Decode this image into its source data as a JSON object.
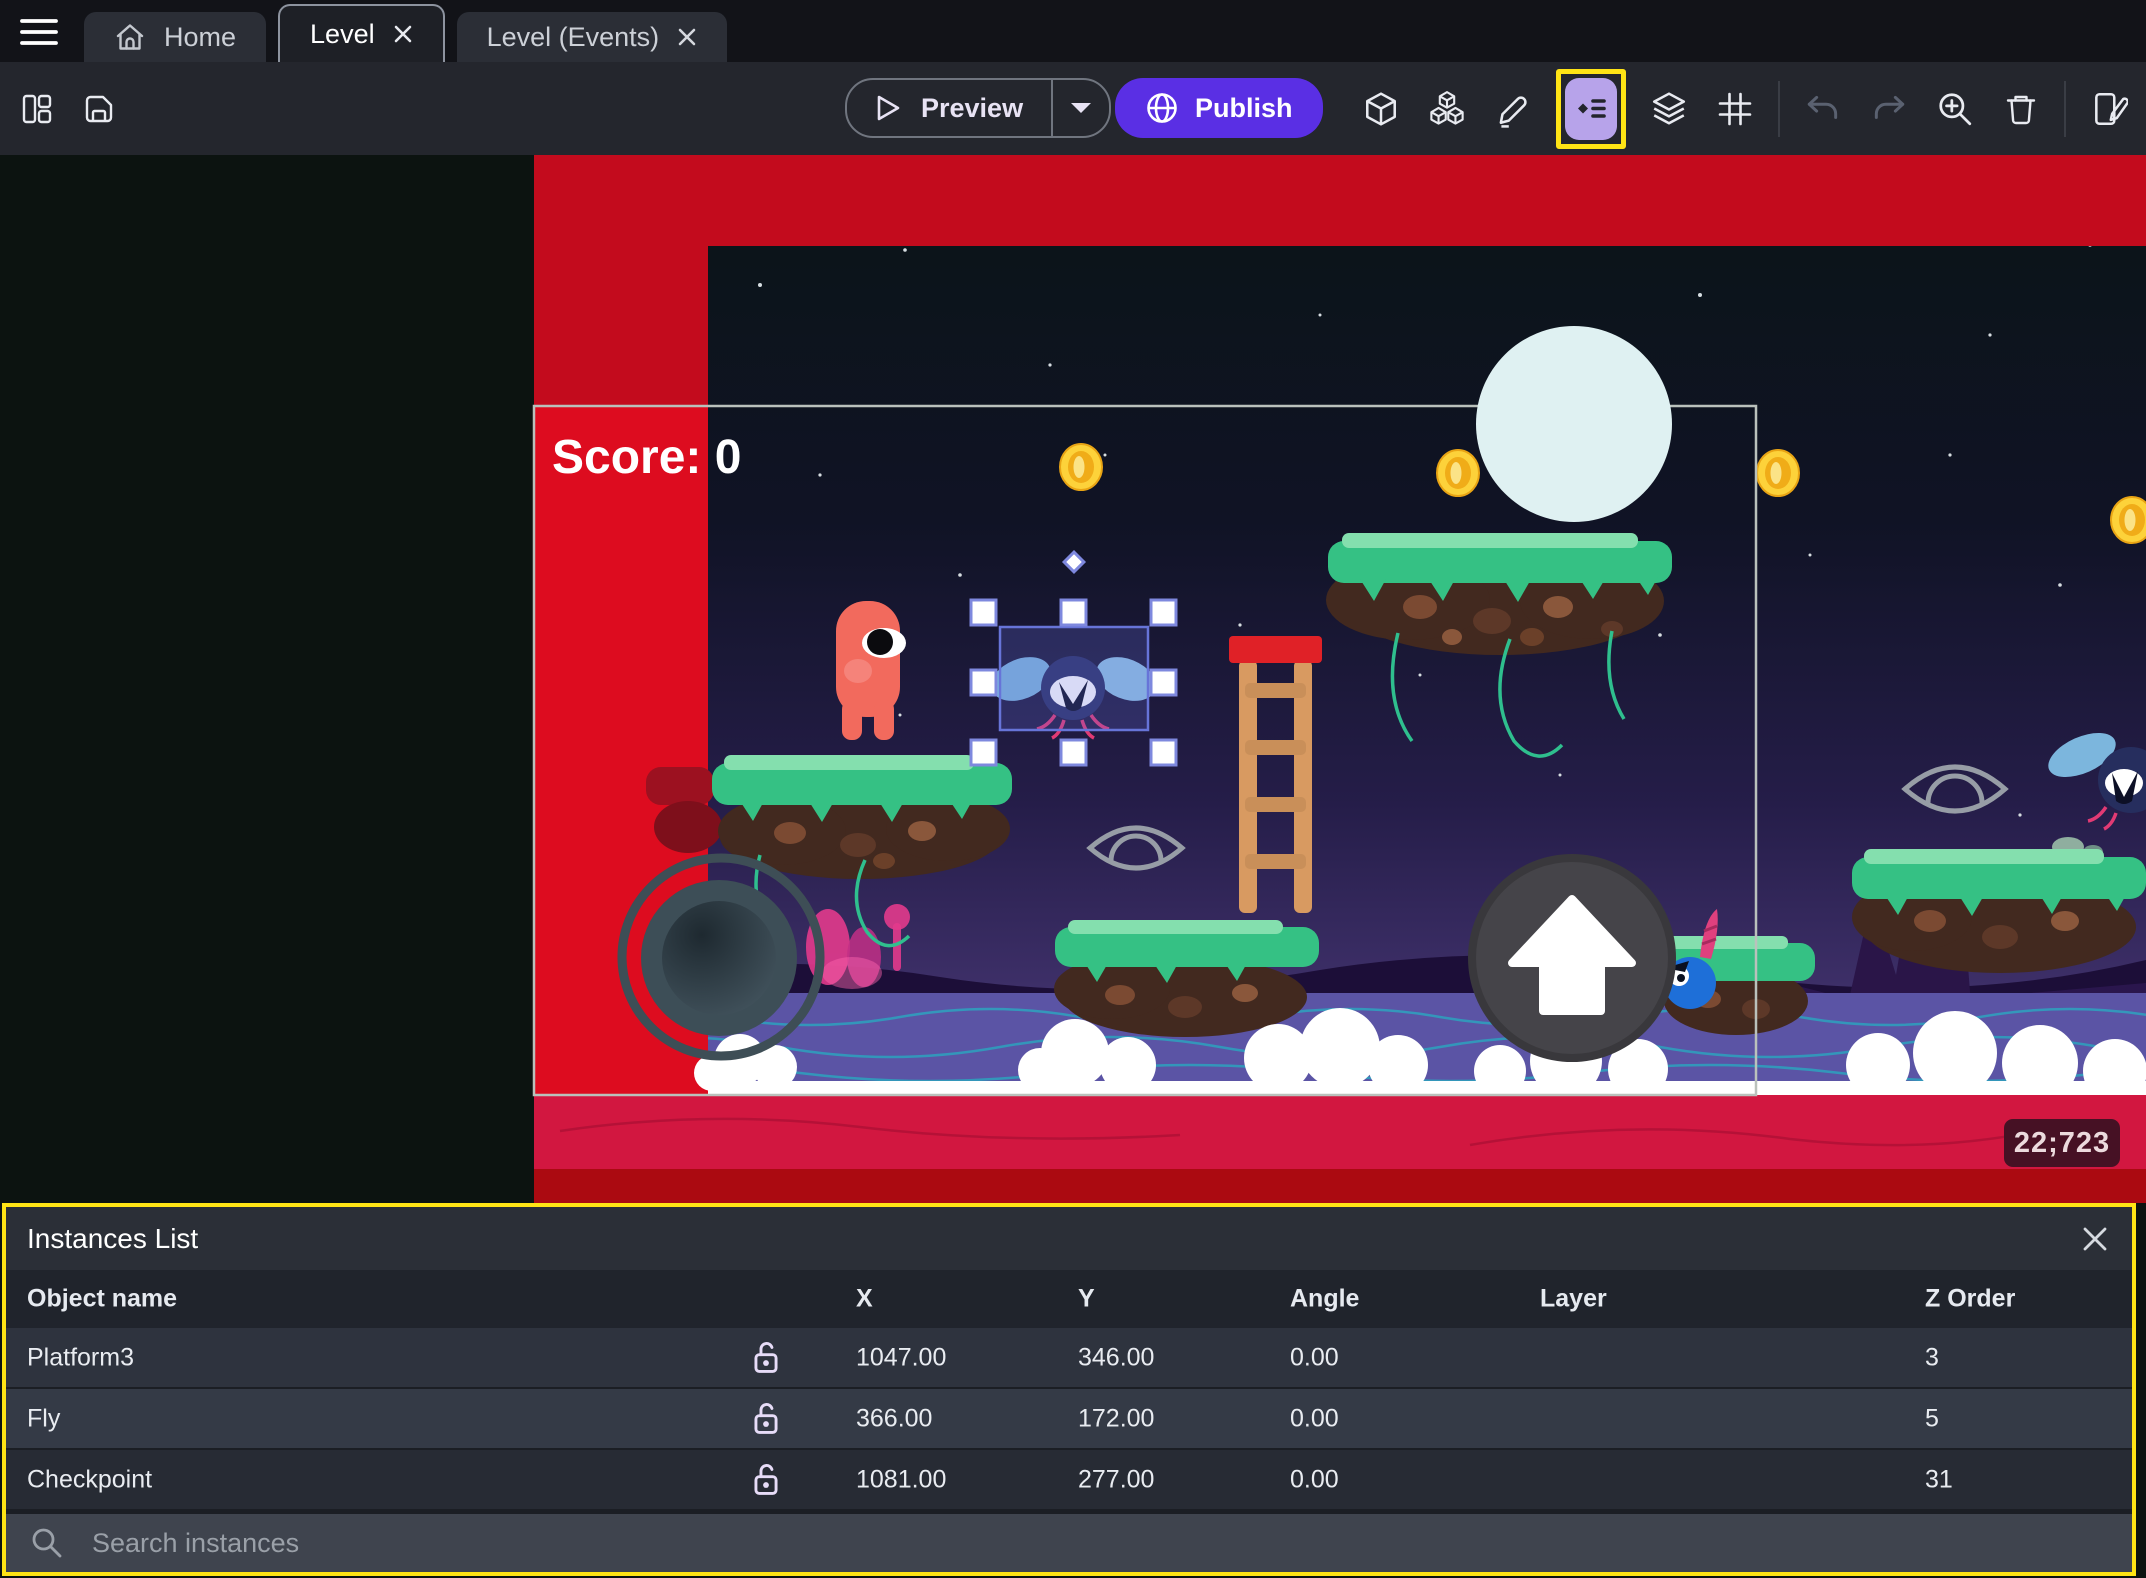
{
  "window": {
    "tabs": [
      {
        "label": "Home",
        "closable": false,
        "active": false
      },
      {
        "label": "Level",
        "closable": true,
        "active": true
      },
      {
        "label": "Level (Events)",
        "closable": true,
        "active": false
      }
    ]
  },
  "toolbar": {
    "preview_label": "Preview",
    "publish_label": "Publish",
    "left_icons": [
      "layout-panels-icon",
      "save-icon"
    ],
    "right_icons": [
      "objects-3d-icon",
      "object-groups-icon",
      "properties-pencil-icon",
      "instances-list-icon (active, yellow highlight)",
      "layers-icon",
      "grid-icon",
      "undo-icon (disabled)",
      "redo-icon (disabled)",
      "zoom-in-icon",
      "delete-icon",
      "scene-notes-icon"
    ]
  },
  "scene": {
    "score": "Score: 0",
    "coords": "22;723",
    "selected_instance": "Fly",
    "visible_objects": [
      "moon",
      "coins",
      "grass platforms",
      "ladder",
      "player-character",
      "fly enemies",
      "eye-outline objects",
      "blue-creature",
      "virtual joystick",
      "jump button",
      "clouds"
    ]
  },
  "instances_panel": {
    "title": "Instances List",
    "columns": {
      "name": "Object name",
      "x": "X",
      "y": "Y",
      "angle": "Angle",
      "layer": "Layer",
      "z": "Z Order"
    },
    "rows": [
      {
        "name": "Platform3",
        "x": "1047.00",
        "y": "346.00",
        "angle": "0.00",
        "layer": "",
        "z": "3"
      },
      {
        "name": "Fly",
        "x": "366.00",
        "y": "172.00",
        "angle": "0.00",
        "layer": "",
        "z": "5"
      },
      {
        "name": "Checkpoint",
        "x": "1081.00",
        "y": "277.00",
        "angle": "0.00",
        "layer": "",
        "z": "31"
      }
    ],
    "search_placeholder": "Search instances"
  },
  "colors": {
    "accent_purple": "#5a2fe4",
    "highlight_yellow": "#ffe415",
    "canvas_red": "#c30b1d",
    "canvas_red_bottom": "#d21740",
    "selection_blue": "#6774d8",
    "active_icon_bg": "#b7a3ea",
    "row_colors": [
      "#2e333e",
      "#343a46",
      "#272b34"
    ]
  }
}
